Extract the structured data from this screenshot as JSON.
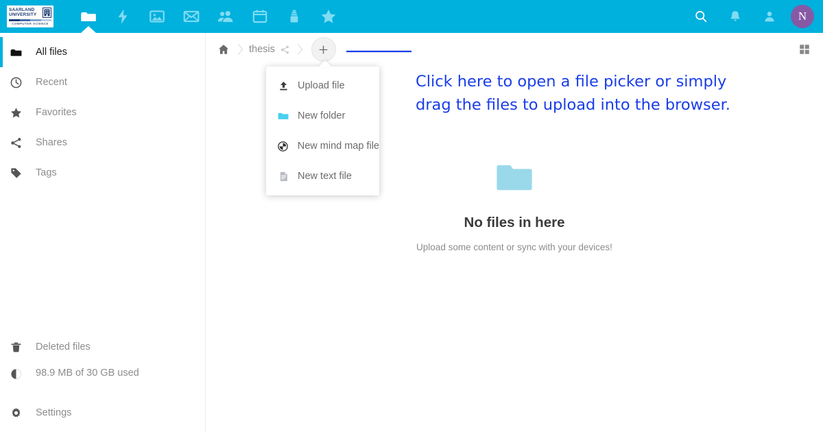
{
  "header": {
    "background_color": "#00b0dd",
    "logo": {
      "name": "saarland-university-logo",
      "line1": "SAARLAND",
      "line2": "UNIVERSITY",
      "subtitle": "COMPUTER SCIENCE"
    },
    "apps": [
      {
        "name": "files-app",
        "icon": "folder-icon",
        "label": "Files",
        "active": true
      },
      {
        "name": "activity-app",
        "icon": "lightning-bolt-icon",
        "label": "Activity",
        "active": false
      },
      {
        "name": "photos-app",
        "icon": "image-icon",
        "label": "Photos",
        "active": false
      },
      {
        "name": "mail-app",
        "icon": "envelope-icon",
        "label": "Mail",
        "active": false
      },
      {
        "name": "contacts-app",
        "icon": "people-icon",
        "label": "Contacts",
        "active": false
      },
      {
        "name": "calendar-app",
        "icon": "calendar-icon",
        "label": "Calendar",
        "active": false
      },
      {
        "name": "deck-app",
        "icon": "deck-stack-icon",
        "label": "Deck",
        "active": false
      },
      {
        "name": "favorites-app",
        "icon": "star-icon",
        "label": "Favorites",
        "active": false
      }
    ],
    "right": [
      {
        "name": "search-button",
        "icon": "search-icon",
        "label": "Search"
      },
      {
        "name": "notifications-button",
        "icon": "bell-icon",
        "label": "Notifications"
      },
      {
        "name": "contacts-menu-button",
        "icon": "contact-person-icon",
        "label": "Contacts"
      }
    ],
    "avatar": {
      "initial": "N",
      "color": "#8659a5"
    }
  },
  "sidebar": {
    "items": [
      {
        "name": "sidebar-item-all-files",
        "icon": "folder-icon",
        "label": "All files",
        "active": true
      },
      {
        "name": "sidebar-item-recent",
        "icon": "clock-icon",
        "label": "Recent",
        "active": false
      },
      {
        "name": "sidebar-item-favorites",
        "icon": "star-icon",
        "label": "Favorites",
        "active": false
      },
      {
        "name": "sidebar-item-shares",
        "icon": "share-icon",
        "label": "Shares",
        "active": false
      },
      {
        "name": "sidebar-item-tags",
        "icon": "tag-icon",
        "label": "Tags",
        "active": false
      }
    ],
    "bottom": {
      "deleted_files": {
        "name": "sidebar-item-deleted-files",
        "icon": "trash-icon",
        "label": "Deleted files"
      },
      "quota": {
        "name": "sidebar-quota",
        "icon": "pie-chart-icon",
        "label": "98.9 MB of 30 GB used",
        "used": "98.9 MB",
        "total": "30 GB",
        "percent": 0.32
      },
      "settings": {
        "name": "sidebar-item-settings",
        "icon": "gear-icon",
        "label": "Settings"
      }
    }
  },
  "main": {
    "breadcrumb": {
      "home_icon": "home-icon",
      "separator": "chevron-right-icon",
      "path": [
        {
          "label": "thesis",
          "shared": true
        }
      ],
      "share_icon": "share-icon"
    },
    "new_button": {
      "name": "new-button",
      "icon": "plus-icon",
      "label": "+"
    },
    "grid_toggle": {
      "name": "grid-view-toggle",
      "icon": "grid-view-icon",
      "label": "Grid view"
    },
    "new_menu": {
      "items": [
        {
          "name": "menu-item-upload-file",
          "icon": "upload-icon",
          "label": "Upload file"
        },
        {
          "name": "menu-item-new-folder",
          "icon": "folder-icon",
          "label": "New folder"
        },
        {
          "name": "menu-item-new-mind-map-file",
          "icon": "mind-map-globe-icon",
          "label": "New mind map file"
        },
        {
          "name": "menu-item-new-text-file",
          "icon": "text-file-icon",
          "label": "New text file"
        }
      ]
    },
    "empty_state": {
      "icon": "empty-folder-icon",
      "title": "No files in here",
      "subtitle": "Upload some content or sync with your devices!"
    }
  },
  "annotation": {
    "color": "#1a3ee8",
    "line1": "Click here to open a file picker or simply",
    "line2": "drag the files to upload into the browser."
  }
}
